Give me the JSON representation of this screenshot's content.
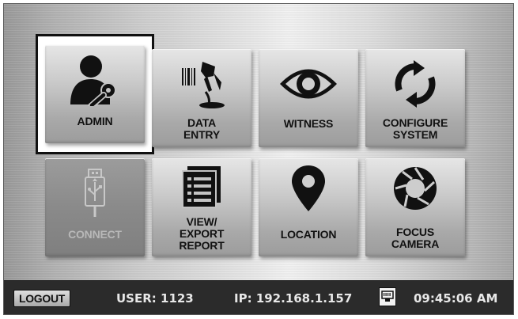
{
  "tiles": [
    {
      "id": "admin",
      "lines": [
        "ADMIN"
      ],
      "icon": "admin-key-icon",
      "selected": true
    },
    {
      "id": "data-entry",
      "lines": [
        "DATA",
        "ENTRY"
      ],
      "icon": "barcode-scanner-icon"
    },
    {
      "id": "witness",
      "lines": [
        "WITNESS"
      ],
      "icon": "eye-icon"
    },
    {
      "id": "configure-system",
      "lines": [
        "CONFIGURE",
        "SYSTEM"
      ],
      "icon": "sync-arrows-icon"
    },
    {
      "id": "connect",
      "lines": [
        "CONNECT"
      ],
      "icon": "usb-icon",
      "disabled": true
    },
    {
      "id": "view-export-report",
      "lines": [
        "VIEW/",
        "EXPORT",
        "REPORT"
      ],
      "icon": "report-list-icon"
    },
    {
      "id": "location",
      "lines": [
        "LOCATION"
      ],
      "icon": "map-pin-icon"
    },
    {
      "id": "focus-camera",
      "lines": [
        "FOCUS",
        "CAMERA"
      ],
      "icon": "aperture-icon"
    }
  ],
  "status": {
    "logout_label": "LOGOUT",
    "user": "USER: 1123",
    "ip": "IP: 192.168.1.157",
    "network_icon": "ethernet-port-icon",
    "time": "09:45:06 AM"
  },
  "colors": {
    "status_bg": "#2b2b2b",
    "status_text": "#e8e8e8",
    "selection_border": "#111111"
  }
}
